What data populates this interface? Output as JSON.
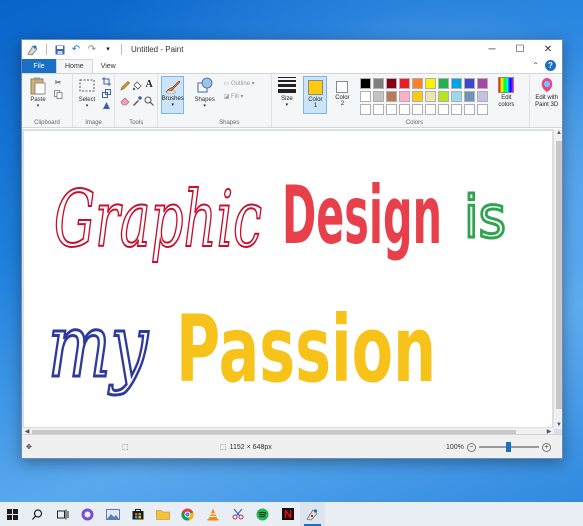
{
  "window": {
    "title": "Untitled - Paint",
    "controls": {
      "minimize": "─",
      "maximize": "☐",
      "close": "✕"
    }
  },
  "ribbon": {
    "tabs": {
      "file": "File",
      "home": "Home",
      "view": "View"
    },
    "clipboard": {
      "paste": "Paste",
      "label": "Clipboard"
    },
    "image": {
      "select": "Select",
      "label": "Image"
    },
    "tools": {
      "label": "Tools"
    },
    "brushes": {
      "label": "Brushes"
    },
    "shapes": {
      "shapes": "Shapes",
      "outline": "Outline",
      "fill": "Fill",
      "label": "Shapes"
    },
    "size": {
      "label": "Size"
    },
    "colors": {
      "color1": "Color",
      "color1_num": "1",
      "color2": "Color",
      "color2_num": "2",
      "edit_colors_1": "Edit",
      "edit_colors_2": "colors",
      "label": "Colors",
      "color1_value": "#ffc90e",
      "color2_value": "#ffffff",
      "palette_row1": [
        "#000000",
        "#7f7f7f",
        "#880015",
        "#ed1c24",
        "#ff7f27",
        "#fff200",
        "#22b14c",
        "#00a2e8",
        "#3f48cc",
        "#a349a4"
      ],
      "palette_row2": [
        "#ffffff",
        "#c3c3c3",
        "#b97a57",
        "#ffaec9",
        "#ffc90e",
        "#efe4b0",
        "#b5e61d",
        "#99d9ea",
        "#7092be",
        "#c8bfe7"
      ],
      "palette_row3": [
        "#ffffff",
        "#ffffff",
        "#ffffff",
        "#ffffff",
        "#ffffff",
        "#ffffff",
        "#ffffff",
        "#ffffff",
        "#ffffff",
        "#ffffff"
      ]
    },
    "paint3d": {
      "line1": "Edit with",
      "line2": "Paint 3D"
    }
  },
  "canvas": {
    "words": {
      "graphic": "Graphic",
      "design": "Design",
      "is": "is",
      "my": "my",
      "passion": "Passion"
    },
    "colors": {
      "graphic": "#c8102e",
      "design": "#e8404a",
      "is": "#2ea44f",
      "my": "#2e3a9e",
      "passion": "#f7c21a"
    }
  },
  "statusbar": {
    "dimensions": "1152 × 648px",
    "zoom": "100%",
    "zoom_fraction": 0.5
  },
  "taskbar": {
    "icons": [
      "windows-start-icon",
      "search-icon",
      "task-view-icon",
      "browser-icon",
      "photos-icon",
      "store-icon",
      "file-explorer-icon",
      "chrome-icon",
      "vlc-icon",
      "snipping-icon",
      "spotify-icon",
      "netflix-icon",
      "paint-icon"
    ]
  }
}
